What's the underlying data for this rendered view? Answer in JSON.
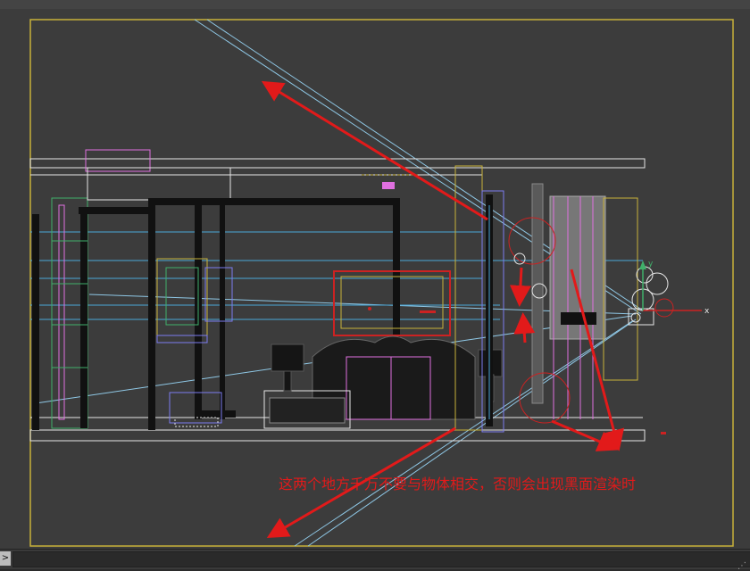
{
  "viewport": {
    "annotation_text": "这两个地方千万不要与物体相交，否则会出现黑面渲染时",
    "axis_x_label": "x",
    "axis_y_label": "y"
  },
  "status_bar": {
    "expand_glyph": ">",
    "grip_glyph": "⋰"
  },
  "colors": {
    "viewport_bg": "#3c3c3c",
    "frame_border": "#c8b23a",
    "annotation": "#e21a1a",
    "camera_line": "#8fc8e6",
    "wire_white": "#e6e6e6",
    "wire_pink": "#e070e0",
    "wire_cyan": "#4aa8d8",
    "wire_red": "#cc2222"
  },
  "icons": [
    "axis-gizmo-icon",
    "camera-icon",
    "expand-icon",
    "resize-grip-icon"
  ]
}
